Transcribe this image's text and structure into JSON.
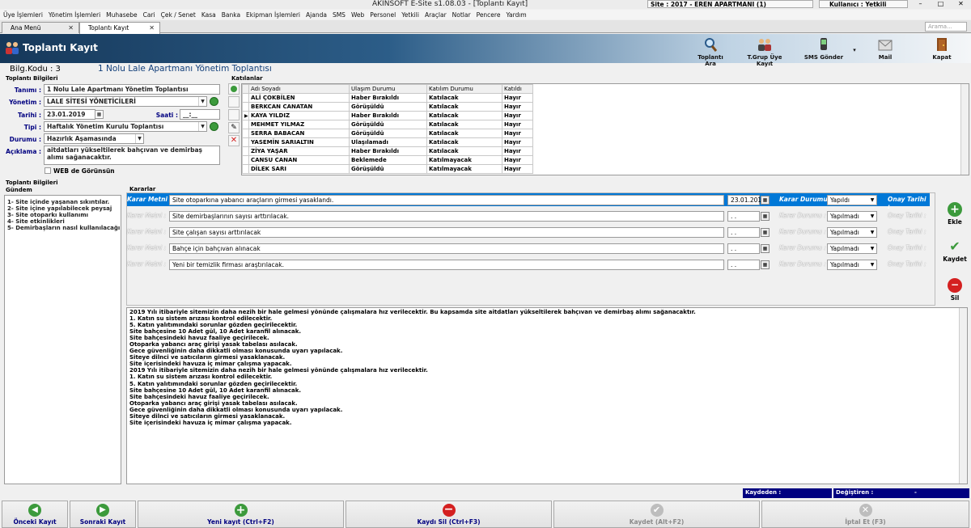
{
  "window": {
    "title": "AKINSOFT E-Site s1.08.03 - [Toplantı Kayıt]",
    "site": "Site : 2017 - EREN APARTMANI (1)",
    "user": "Kullanıcı : Yetkili",
    "min": "–",
    "max": "□",
    "close": "✕"
  },
  "menu": [
    "Üye İşlemleri",
    "Yönetim İşlemleri",
    "Muhasebe",
    "Cari",
    "Çek / Senet",
    "Kasa",
    "Banka",
    "Ekipman İşlemleri",
    "Ajanda",
    "SMS",
    "Web",
    "Personel",
    "Yetkili",
    "Araçlar",
    "Notlar",
    "Pencere",
    "Yardım"
  ],
  "tabs": [
    {
      "label": "Ana Menü",
      "close": "✕"
    },
    {
      "label": "Toplantı Kayıt",
      "close": "✕"
    }
  ],
  "search": {
    "placeholder": "Arama..."
  },
  "header": {
    "title": "Toplantı Kayıt",
    "buttons": {
      "ara": "Toplantı Ara",
      "grup": "T.Grup Üye Kayıt",
      "sms": "SMS Gönder",
      "mail": "Mail",
      "kapat": "Kapat"
    }
  },
  "info": {
    "bilg_kodu": "Bilg.Kodu : 3",
    "title": "1 Nolu Lale Apartmanı Yönetim Toplantısı"
  },
  "form": {
    "section": "Toplantı Bilgileri",
    "tanimi_label": "Tanımı :",
    "tanimi": "1 Nolu Lale Apartmanı Yönetim Toplantısı",
    "yonetim_label": "Yönetim :",
    "yonetim": "LALE SİTESİ YÖNETİCİLERİ",
    "tarih_label": "Tarihi :",
    "tarih": "23.01.2019",
    "saat_label": "Saati :",
    "saat": "__:__",
    "tipi_label": "Tipi :",
    "tipi": "Haftalık Yönetim Kurulu Toplantısı",
    "durum_label": "Durumu :",
    "durum": "Hazırlık Aşamasında",
    "aciklama_label": "Açıklama :",
    "aciklama": "aitdatları yükseltilerek bahçıvan ve demirbaş alımı sağanacaktır.",
    "web_label": "WEB de Görünsün"
  },
  "katilanlar": {
    "section": "Katılanlar",
    "columns": [
      "Adı Soyadı",
      "Ulaşım Durumu",
      "Katılım Durumu",
      "Katıldı"
    ],
    "rows": [
      [
        "ALİ ÇOKBİLEN",
        "Haber Bırakıldı",
        "Katılacak",
        "Hayır"
      ],
      [
        "BERKCAN CANATAN",
        "Görüşüldü",
        "Katılacak",
        "Hayır"
      ],
      [
        "KAYA YILDIZ",
        "Haber Bırakıldı",
        "Katılacak",
        "Hayır"
      ],
      [
        "MEHMET YILMAZ",
        "Görüşüldü",
        "Katılacak",
        "Hayır"
      ],
      [
        "SERRA BABACAN",
        "Görüşüldü",
        "Katılacak",
        "Hayır"
      ],
      [
        "YASEMİN SARIALTIN",
        "Ulaşılamadı",
        "Katılacak",
        "Hayır"
      ],
      [
        "ZİYA YAŞAR",
        "Haber Bırakıldı",
        "Katılacak",
        "Hayır"
      ],
      [
        "CANSU CANAN",
        "Beklemede",
        "Katılmayacak",
        "Hayır"
      ],
      [
        "DİLEK SARI",
        "Görüşüldü",
        "Katılmayacak",
        "Hayır"
      ]
    ]
  },
  "gundem": {
    "section": "Toplantı Bilgileri",
    "label": "Gündem",
    "items": [
      "1- Site içinde yaşanan sıkıntılar.",
      "2- Site içine yapılabilecek peysaj",
      "3- Site otoparkı kullanımı",
      "4- Site etkinlikleri",
      "5- Demirbaşların nasıl kullanılacağı"
    ]
  },
  "kararlar": {
    "section": "Kararlar",
    "metni_label": "Karar Metni :",
    "durum_label": "Karar Durumu :",
    "onay_label": "Onay Tarihi :",
    "rows": [
      {
        "text": "Site otoparkına yabancı araçların girmesi yasaklandı.",
        "date": "23.01.201",
        "status": "Yapıldı"
      },
      {
        "text": "Site demirbaşlarının sayısı arttırılacak.",
        "date": ". .",
        "status": "Yapılmadı"
      },
      {
        "text": "Site çalışan sayısı arttırılacak",
        "date": ". .",
        "status": "Yapılmadı"
      },
      {
        "text": "Bahçe için bahçıvan alınacak",
        "date": ". .",
        "status": "Yapılmadı"
      },
      {
        "text": "Yeni bir temizlik firması araştırılacak.",
        "date": ". .",
        "status": "Yapılmadı"
      }
    ],
    "buttons": {
      "ekle": "Ekle",
      "kaydet": "Kaydet",
      "sil": "Sil"
    }
  },
  "memo": [
    "2019 Yılı itibariyle sitemizin daha nezih bir hale gelmesi yönünde çalışmalara hız verilecektir. Bu kapsamda site aitdatları yükseltilerek bahçıvan ve demirbaş alımı sağanacaktır.",
    "1. Katın su sistem arızası kontrol edilecektir.",
    "5. Katın yalıtımındaki sorunlar gözden geçirilecektir.",
    "Site bahçesine 10 Adet gül, 10 Adet karanfil alınacak.",
    "Site bahçesindeki havuz faaliye geçirilecek.",
    "Otoparka yabancı araç girişi yasak tabelası asılacak.",
    "Gece güvenliğinin daha dikkatli olması konusunda uyarı yapılacak.",
    "Siteye dilnci ve satıcıların girmesi yasaklanacak.",
    "Site içerisindeki havuza iç mimar çalışma yapacak.",
    "2019 Yılı itibariyle sitemizin daha nezih bir hale gelmesi yönünde çalışmalara hız verilecektir.",
    "1. Katın su sistem arızası kontrol edilecektir.",
    "5. Katın yalıtımındaki sorunlar gözden geçirilecektir.",
    "Site bahçesine 10 Adet gül, 10 Adet karanfil alınacak.",
    "Site bahçesindeki havuz faaliye geçirilecek.",
    "Otoparka yabancı araç girişi yasak tabelası asılacak.",
    "Gece güvenliğinin daha dikkatli olması konusunda uyarı yapılacak.",
    "Siteye dilnci ve satıcıların girmesi yasaklanacak.",
    "Site içerisindeki havuza iç mimar çalışma yapacak."
  ],
  "status": {
    "kaydeden": "Kaydeden :",
    "degistiren": "Değiştiren :",
    "dash": "-"
  },
  "footer": {
    "onceki": "Önceki Kayıt",
    "sonraki": "Sonraki Kayıt",
    "yeni": "Yeni kayıt (Ctrl+F2)",
    "sil": "Kaydı Sil (Ctrl+F3)",
    "kaydet": "Kaydet (Alt+F2)",
    "iptal": "İptal Et (F3)"
  },
  "colors": {
    "accent": "#0078d7",
    "label": "#000080",
    "header_dark": "#16385a",
    "green": "#3c9a3c",
    "red": "#d42020"
  }
}
